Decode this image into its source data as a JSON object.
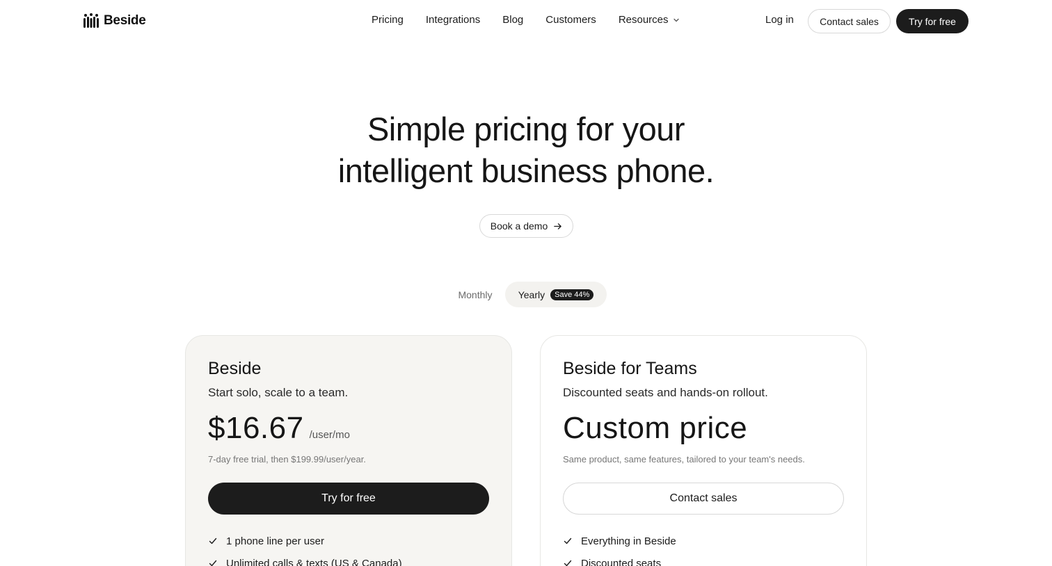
{
  "nav": {
    "logo_text": "Beside",
    "links": [
      {
        "label": "Pricing"
      },
      {
        "label": "Integrations"
      },
      {
        "label": "Blog"
      },
      {
        "label": "Customers"
      },
      {
        "label": "Resources",
        "icon": "chevron-down-icon"
      }
    ],
    "login_label": "Log in",
    "contact_label": "Contact sales",
    "try_label": "Try for free"
  },
  "hero": {
    "title_line1": "Simple pricing for your",
    "title_line2": "intelligent business phone.",
    "demo_label": "Book a demo",
    "demo_icon": "arrow-right-icon"
  },
  "billing_toggle": {
    "monthly_label": "Monthly",
    "yearly_label": "Yearly",
    "save_badge": "Save 44%",
    "selected": "Yearly"
  },
  "plans": [
    {
      "title": "Beside",
      "subtitle": "Start solo, scale to a team.",
      "price": "$16.67",
      "price_unit": "/user/mo",
      "note": "7-day free trial, then $199.99/user/year.",
      "cta_label": "Try for free",
      "features": [
        "1 phone line per user",
        "Unlimited calls & texts (US & Canada)"
      ]
    },
    {
      "title": "Beside for Teams",
      "subtitle": "Discounted seats and hands-on rollout.",
      "price": "Custom price",
      "price_unit": "",
      "note": "Same product, same features, tailored to your team's needs.",
      "cta_label": "Contact sales",
      "features": [
        "Everything in Beside",
        "Discounted seats"
      ]
    }
  ],
  "colors": {
    "dark": "#1c1c1c",
    "card_bg": "#f6f5f2",
    "toggle_bg": "#f3f2ef",
    "border": "#d8d8d8"
  }
}
